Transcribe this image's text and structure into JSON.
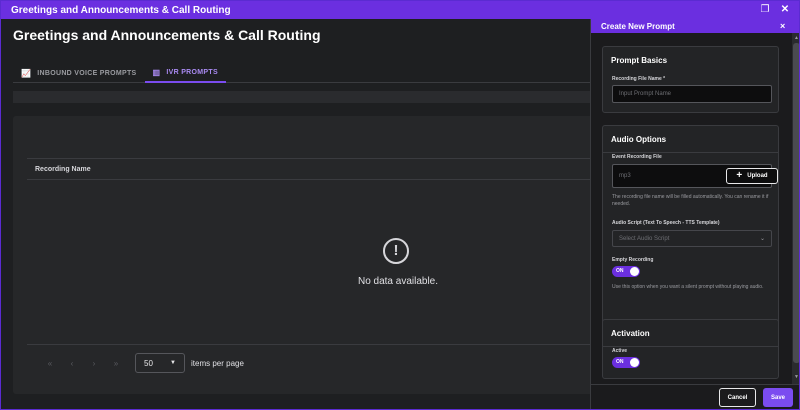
{
  "window": {
    "title": "Greetings and Announcements & Call Routing",
    "restore_icon": "restore-icon",
    "close_icon": "close-icon"
  },
  "page": {
    "title": "Greetings and Announcements & Call Routing"
  },
  "tabs": [
    {
      "label": "INBOUND VOICE PROMPTS",
      "icon": "chart-icon",
      "active": false
    },
    {
      "label": "IVR PROMPTS",
      "icon": "bars-icon",
      "active": true
    }
  ],
  "table": {
    "columns": [
      "Recording Name"
    ],
    "empty_message": "No data available."
  },
  "pagination": {
    "first": "«",
    "prev": "‹",
    "next": "›",
    "last": "»",
    "per_page": "50",
    "per_page_label": "items per page"
  },
  "drawer": {
    "title": "Create New Prompt",
    "close": "×",
    "basics": {
      "heading": "Prompt Basics",
      "file_name_label": "Recording File Name *",
      "file_name_placeholder": "Input Prompt Name"
    },
    "audio": {
      "heading": "Audio Options",
      "event_file_label": "Event Recording File",
      "event_file_placeholder": "mp3",
      "upload_label": "Upload",
      "help_text": "The recording file name will be filled automatically. You can rename it if needed.",
      "script_label": "Audio Script (Text To Speech - TTS Template)",
      "script_placeholder": "Select Audio Script",
      "empty_label": "Empty Recording",
      "empty_toggle": "ON",
      "empty_help": "Use this option when you want a silent prompt without playing audio."
    },
    "activation": {
      "heading": "Activation",
      "active_label": "Active",
      "active_toggle": "ON"
    },
    "cancel_label": "Cancel",
    "save_label": "Save"
  },
  "colors": {
    "accent": "#6b2fe0",
    "accent_light": "#a98af2",
    "background": "#1e1f21"
  }
}
